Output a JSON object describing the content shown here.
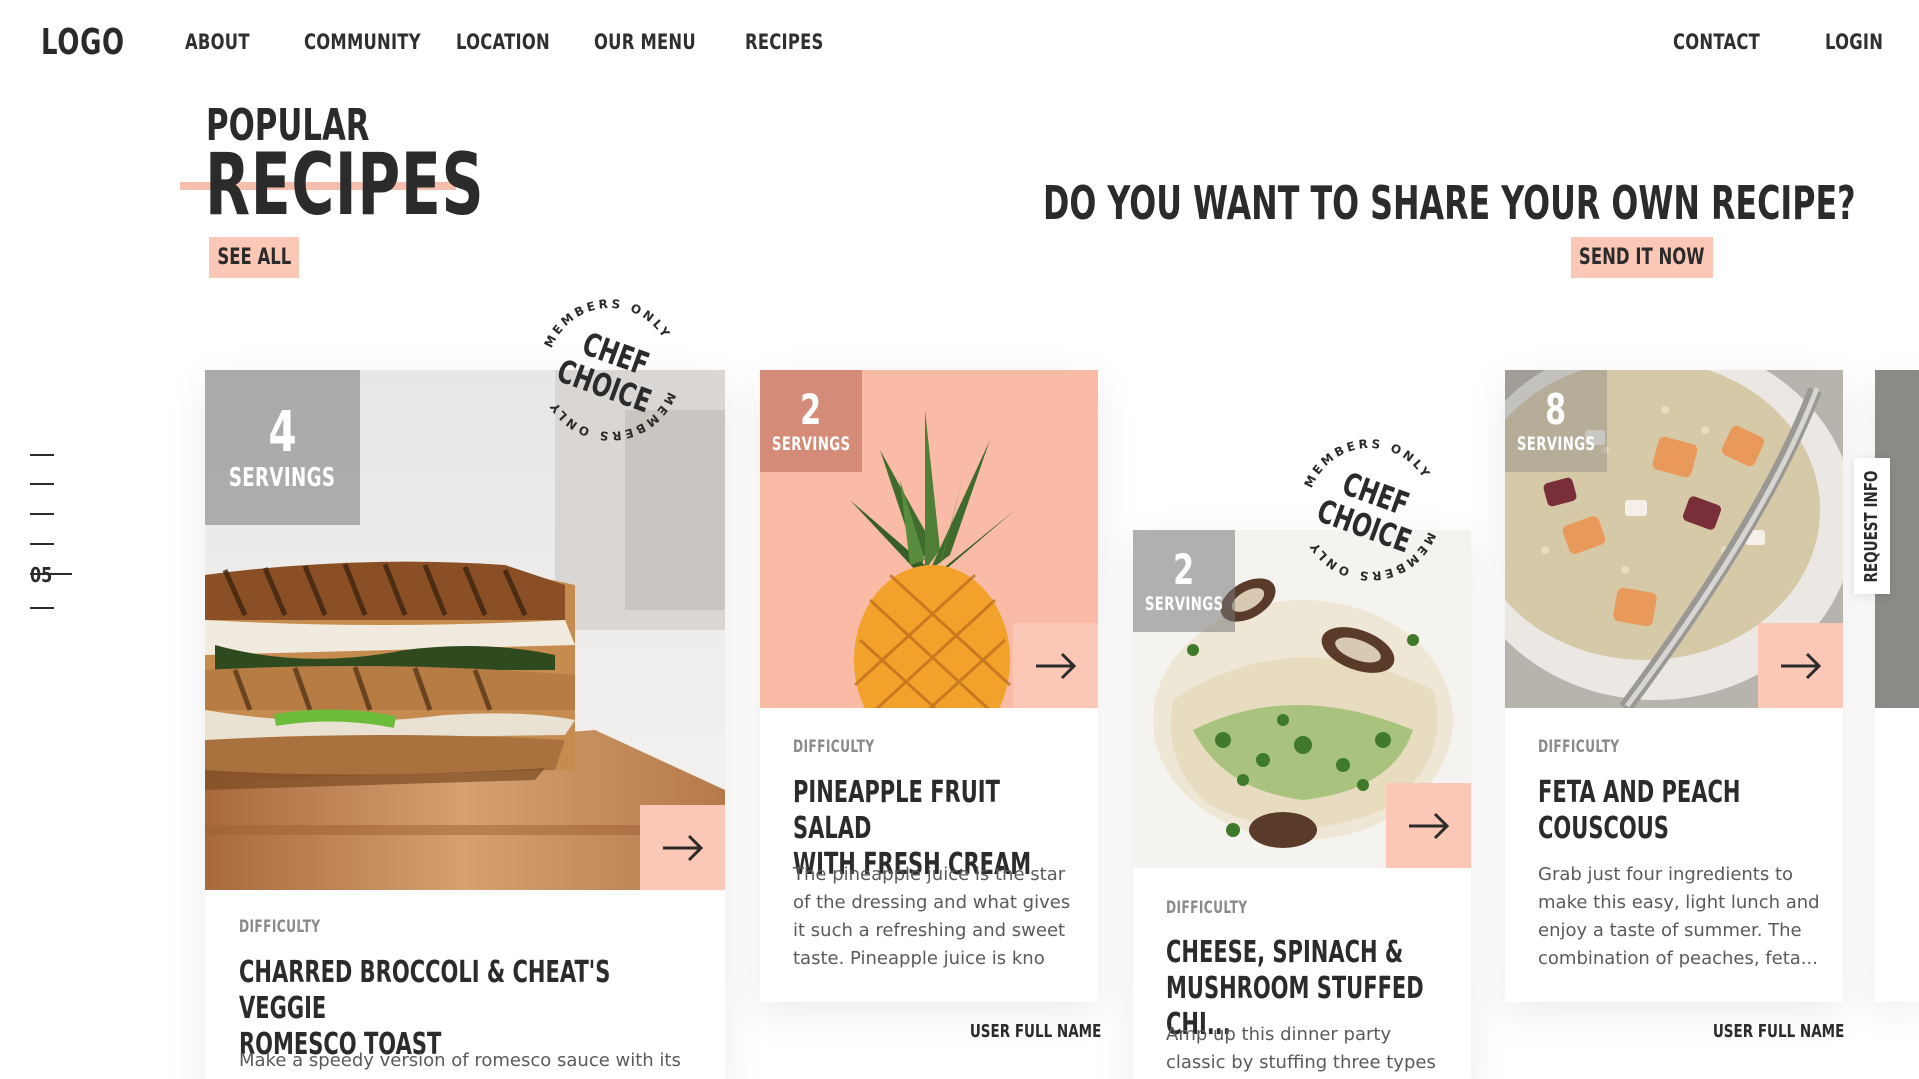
{
  "nav": {
    "logo": "LOGO",
    "items": [
      "ABOUT",
      "COMMUNITY",
      "LOCATION",
      "OUR MENU",
      "RECIPES"
    ],
    "contact": "CONTACT",
    "login": "LOGIN"
  },
  "hero": {
    "kicker": "POPULAR",
    "title": "RECIPES",
    "see_all": "SEE ALL",
    "share_question": "DO YOU WANT TO SHARE YOUR OWN RECIPE?",
    "send_now": "SEND IT NOW"
  },
  "pager": {
    "current": "05"
  },
  "badge": {
    "line1": "CHEF",
    "line2": "CHOICE",
    "ring": "MEMBERS ONLY"
  },
  "cards": [
    {
      "servings": "4",
      "servings_label": "SERVINGS",
      "difficulty": "DIFFICULTY",
      "title": "CHARRED BROCCOLI & CHEAT'S VEGGIE\nROMESCO TOAST",
      "desc": "Make a speedy version of romesco sauce with its",
      "user": ""
    },
    {
      "servings": "2",
      "servings_label": "SERVINGS",
      "difficulty": "DIFFICULTY",
      "title": "PINEAPPLE FRUIT SALAD\nWITH FRESH CREAM",
      "desc": "The pineapple juice is the star of the dressing and what gives it such a refreshing and sweet taste. Pineapple juice is kno",
      "user": "USER FULL NAME"
    },
    {
      "servings": "2",
      "servings_label": "SERVINGS",
      "difficulty": "DIFFICULTY",
      "title": "CHEESE, SPINACH &\nMUSHROOM STUFFED CHI...",
      "desc": "Amp up this dinner party classic by stuffing three types",
      "user": ""
    },
    {
      "servings": "8",
      "servings_label": "SERVINGS",
      "difficulty": "DIFFICULTY",
      "title": "FETA AND PEACH\nCOUSCOUS",
      "desc": "Grab just four ingredients to make this easy, light lunch and enjoy a taste of summer. The combination of peaches, feta...",
      "user": "USER FULL NAME"
    }
  ],
  "request_info": "REQUEST INFO",
  "colors": {
    "accent": "#fbc8b8",
    "peach_bg": "#f9bba6",
    "text": "#2b2b2b"
  }
}
